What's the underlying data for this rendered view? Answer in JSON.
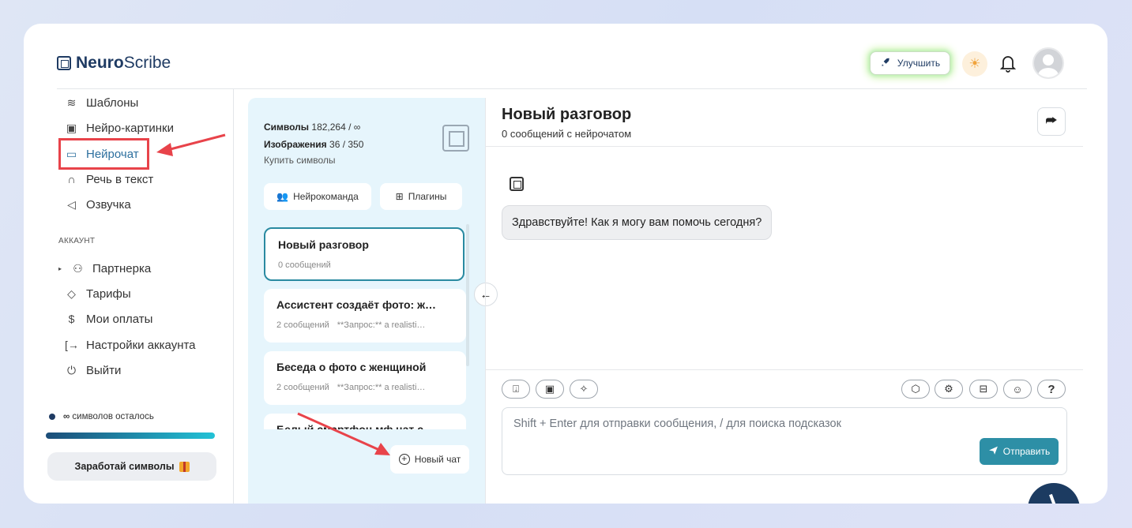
{
  "brand": {
    "name_bold": "Neuro",
    "name_rest": "Scribe"
  },
  "header": {
    "upgrade_label": "Улучшить"
  },
  "sidebar": {
    "items": [
      {
        "label": "Шаблоны",
        "icon": "layers-icon"
      },
      {
        "label": "Нейро-картинки",
        "icon": "image-icon"
      },
      {
        "label": "Нейрочат",
        "icon": "chat-icon"
      },
      {
        "label": "Речь в текст",
        "icon": "headphones-icon"
      },
      {
        "label": "Озвучка",
        "icon": "speaker-icon"
      }
    ],
    "account_label": "АККАУНТ",
    "account_items": [
      {
        "label": "Партнерка",
        "icon": "users-icon"
      },
      {
        "label": "Тарифы",
        "icon": "tag-icon"
      },
      {
        "label": "Мои оплаты",
        "icon": "dollar-icon"
      },
      {
        "label": "Настройки аккаунта",
        "icon": "logout-arrow-icon"
      },
      {
        "label": "Выйти",
        "icon": "power-icon"
      }
    ],
    "remaining_symbol": "∞",
    "remaining_text": "символов осталось",
    "earn_label": "Заработай символы"
  },
  "panel": {
    "symbols_label": "Символы",
    "symbols_value": "182,264 / ∞",
    "images_label": "Изображения",
    "images_value": "36 / 350",
    "buy_label": "Купить символы",
    "team_label": "Нейрокоманда",
    "plugins_label": "Плагины",
    "chats": [
      {
        "title": "Новый разговор",
        "meta": "0 сообщений",
        "preview": ""
      },
      {
        "title": "Ассистент создаёт фото: ж…",
        "meta": "2 сообщений",
        "preview": "**Запрос:** a realisti…"
      },
      {
        "title": "Беседа о фото с женщиной",
        "meta": "2 сообщений",
        "preview": "**Запрос:** a realisti…"
      },
      {
        "title": "Белый смартфон мф чат с…",
        "meta": "",
        "preview": ""
      }
    ],
    "new_chat_label": "Новый чат"
  },
  "chat": {
    "title": "Новый разговор",
    "subtitle": "0 сообщений с нейрочатом",
    "greeting": "Здравствуйте! Как я могу вам помочь сегодня?",
    "input_placeholder": "Shift + Enter для отправки сообщения, / для поиска подсказок",
    "send_label": "Отправить",
    "help_label": "?"
  },
  "colors": {
    "accent": "#2d8fa6",
    "brand": "#1f3b63",
    "annotation": "#e8434a",
    "panel_bg": "#e6f5fc"
  }
}
